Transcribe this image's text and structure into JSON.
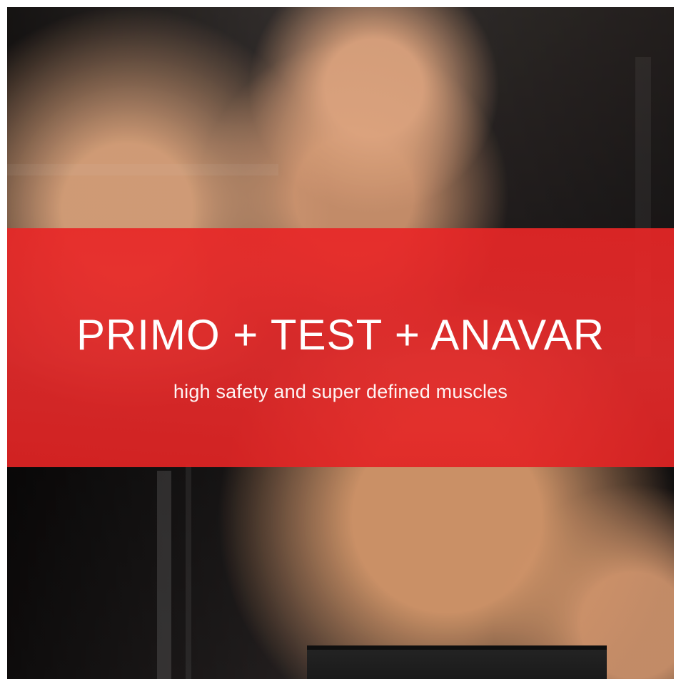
{
  "image": {
    "headline": "PRIMO + TEST + ANAVAR",
    "subheadline": "high safety and super defined muscles",
    "accent_color": "#E82626"
  }
}
